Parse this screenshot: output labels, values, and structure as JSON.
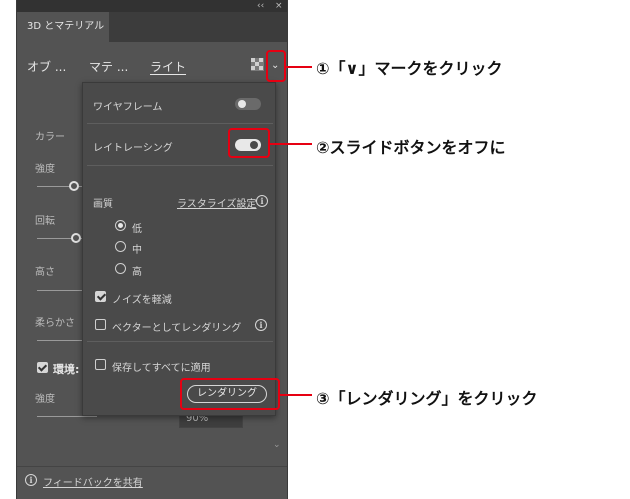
{
  "panel": {
    "topbar_controls": [
      "‹‹",
      "×"
    ],
    "tab_label": "3D とマテリアル",
    "subtabs": [
      {
        "label": "オブ ..."
      },
      {
        "label": "マテ ..."
      },
      {
        "label": "ライト",
        "active": true
      }
    ],
    "background": {
      "color_label": "カラー",
      "intensity_label": "強度",
      "rotation_label": "回転",
      "height_label": "高さ",
      "softness_label": "柔らかさ",
      "environment_label": "環境:",
      "intensity2_label": "強度",
      "value_text": "90%"
    },
    "footer_link": "フィードバックを共有"
  },
  "popup": {
    "wireframe_label": "ワイヤフレーム",
    "raytracing_label": "レイトレーシング",
    "quality_label": "画質",
    "rasterize_link": "ラスタライズ設定",
    "quality_options": [
      "低",
      "中",
      "高"
    ],
    "noise_label": "ノイズを軽減",
    "vector_label": "ベクターとしてレンダリング",
    "save_apply_label": "保存してすべてに適用",
    "render_button": "レンダリング"
  },
  "annotations": {
    "step1": "①「∨」マークをクリック",
    "step2": "②スライドボタンをオフに",
    "step3": "③「レンダリング」をクリック"
  },
  "colors": {
    "panel_bg": "#535353",
    "popup_bg": "#4a4a4a",
    "highlight": "#e60012"
  }
}
